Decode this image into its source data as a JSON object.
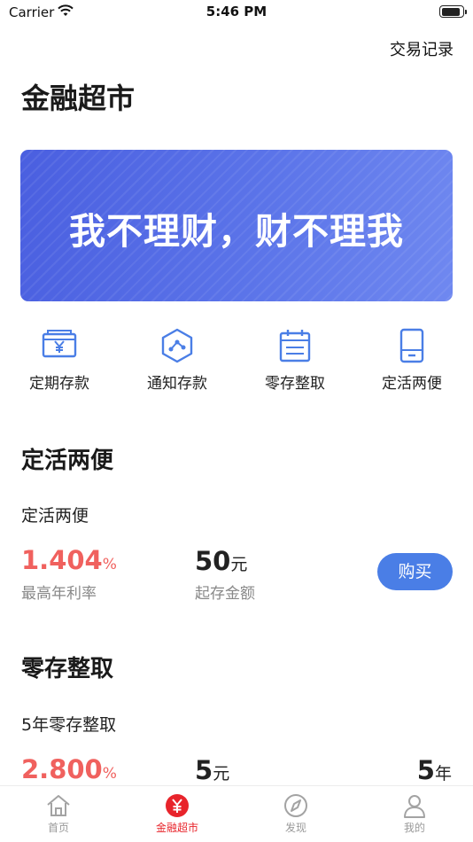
{
  "status_bar": {
    "carrier": "Carrier",
    "time": "5:46 PM",
    "battery_level": 0.9
  },
  "header": {
    "trade_records": "交易记录",
    "title": "金融超市"
  },
  "banner": {
    "text": "我不理财，财不理我"
  },
  "quick_actions": [
    {
      "label": "定期存款",
      "icon": "cash-box-icon"
    },
    {
      "label": "通知存款",
      "icon": "hexagon-link-icon"
    },
    {
      "label": "零存整取",
      "icon": "calendar-icon"
    },
    {
      "label": "定活两便",
      "icon": "phone-card-icon"
    }
  ],
  "sections": [
    {
      "title": "定活两便",
      "product": "定活两便",
      "rate": "1.404",
      "rate_unit": "%",
      "rate_caption": "最高年利率",
      "amount": "50",
      "amount_unit": "元",
      "amount_caption": "起存金额",
      "button": "购买"
    },
    {
      "title": "零存整取",
      "product": "5年零存整取",
      "rate": "2.800",
      "rate_unit": "%",
      "amount": "5",
      "amount_unit": "元",
      "term": "5",
      "term_unit": "年"
    }
  ],
  "tab_bar": {
    "tabs": [
      {
        "label": "首页",
        "icon": "home-icon"
      },
      {
        "label": "金融超市",
        "icon": "yen-circle-icon",
        "active": true
      },
      {
        "label": "发现",
        "icon": "compass-icon"
      },
      {
        "label": "我的",
        "icon": "person-icon"
      }
    ]
  },
  "colors": {
    "accent": "#4a7ee6",
    "rate_red": "#f0615e",
    "tab_active": "#e8242b",
    "banner": "#5468e4"
  }
}
